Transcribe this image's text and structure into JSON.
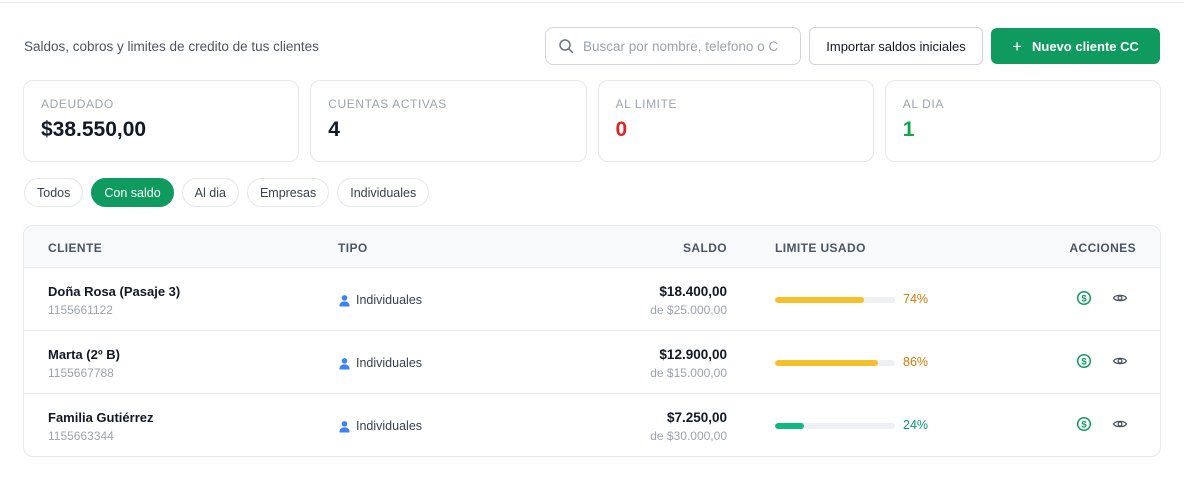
{
  "header": {
    "subtitle": "Saldos, cobros y limites de credito de tus clientes",
    "search_placeholder": "Buscar por nombre, telefono o C",
    "import_label": "Importar saldos iniciales",
    "new_label": "Nuevo cliente CC",
    "new_icon": "plus-icon",
    "search_icon": "search-icon"
  },
  "cards": [
    {
      "label": "ADEUDADO",
      "value": "$38.550,00"
    },
    {
      "label": "CUENTAS ACTIVAS",
      "value": "4"
    },
    {
      "label": "AL LIMITE",
      "value": "0",
      "color": "#dc2626"
    },
    {
      "label": "AL DIA",
      "value": "1",
      "color": "#16a34a"
    }
  ],
  "filters": {
    "items": [
      "Todos",
      "Con saldo",
      "Al dia",
      "Empresas",
      "Individuales"
    ],
    "active": "Con saldo"
  },
  "table": {
    "headers": {
      "cliente": "CLIENTE",
      "tipo": "TIPO",
      "saldo": "SALDO",
      "limite": "LIMITE USADO",
      "acciones": "ACCIONES"
    },
    "rows": [
      {
        "name": "Doña Rosa (Pasaje 3)",
        "phone": "1155661122",
        "type": "Individuales",
        "saldo": "$18.400,00",
        "limit": "de $25.000,00",
        "usage": 0.74,
        "usage_label": "74%",
        "bar_color": "#f5c02b",
        "pct_color": "#d97706"
      },
      {
        "name": "Marta (2º B)",
        "phone": "1155667788",
        "type": "Individuales",
        "saldo": "$12.900,00",
        "limit": "de $15.000,00",
        "usage": 0.86,
        "usage_label": "86%",
        "bar_color": "#f5c02b",
        "pct_color": "#d97706"
      },
      {
        "name": "Familia Gutiérrez",
        "phone": "1155663344",
        "type": "Individuales",
        "saldo": "$7.250,00",
        "limit": "de $30.000,00",
        "usage": 0.24,
        "usage_label": "24%",
        "bar_color": "#10b981",
        "pct_color": "#059669"
      }
    ],
    "row_icons": {
      "type": "person-icon",
      "pay": "dollar-icon",
      "view": "eye-icon"
    },
    "accent": "#0f9a5f"
  }
}
